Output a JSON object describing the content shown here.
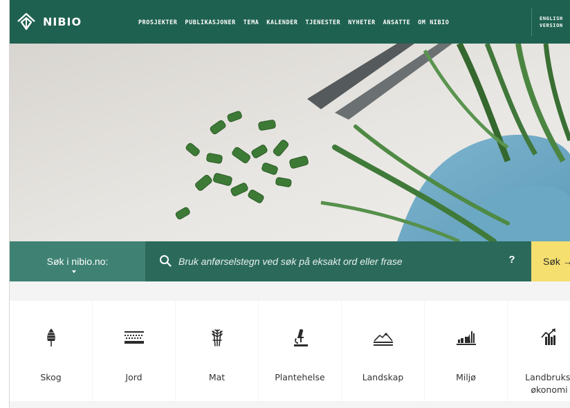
{
  "header": {
    "logo_text": "NIBIO",
    "nav": [
      "PROSJEKTER",
      "PUBLIKASJONER",
      "TEMA",
      "KALENDER",
      "TJENESTER",
      "NYHETER",
      "ANSATTE",
      "OM NIBIO"
    ],
    "english_line1": "ENGLISH",
    "english_line2": "VERSION",
    "background_color": "#1f6150"
  },
  "search": {
    "scope_label": "Søk i nibio.no:",
    "placeholder": "Bruk anførselstegn ved søk på eksakt ord eller frase",
    "help_label": "?",
    "submit_label": "Søk →",
    "submit_color": "#f5df6f"
  },
  "topics": [
    {
      "label": "Skog",
      "icon": "tree-icon"
    },
    {
      "label": "Jord",
      "icon": "soil-layers-icon"
    },
    {
      "label": "Mat",
      "icon": "wheat-icon"
    },
    {
      "label": "Plantehelse",
      "icon": "microscope-icon"
    },
    {
      "label": "Landskap",
      "icon": "landscape-icon"
    },
    {
      "label": "Miljø",
      "icon": "environment-icon"
    },
    {
      "label_line1": "Landbruks-",
      "label_line2": "økonomi",
      "icon": "economy-chart-icon"
    }
  ]
}
